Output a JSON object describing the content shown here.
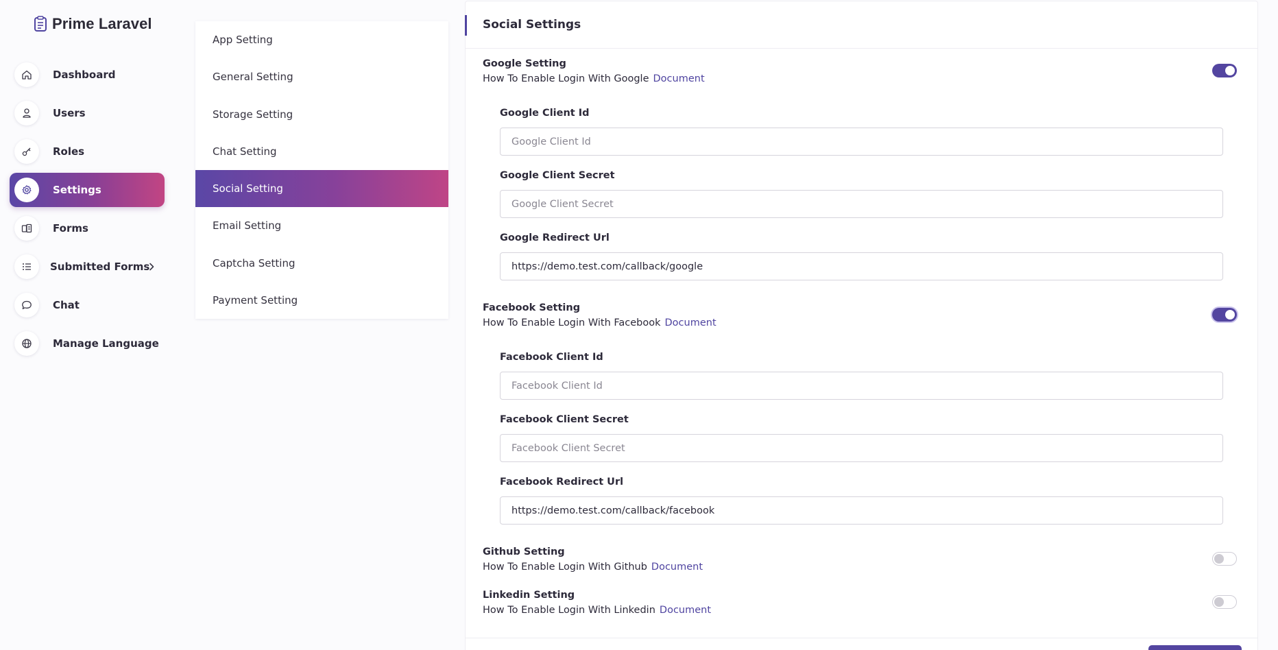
{
  "app": {
    "title": "Prime Laravel"
  },
  "sidebar": {
    "items": [
      {
        "label": "Dashboard",
        "icon": "home-icon"
      },
      {
        "label": "Users",
        "icon": "user-icon"
      },
      {
        "label": "Roles",
        "icon": "key-icon"
      },
      {
        "label": "Settings",
        "icon": "gear-icon",
        "active": true
      },
      {
        "label": "Forms",
        "icon": "form-icon"
      },
      {
        "label": "Submitted Forms",
        "icon": "list-icon",
        "expandable": true
      },
      {
        "label": "Chat",
        "icon": "chat-icon"
      },
      {
        "label": "Manage Language",
        "icon": "globe-icon"
      }
    ]
  },
  "submenu": {
    "items": [
      {
        "label": "App Setting"
      },
      {
        "label": "General Setting"
      },
      {
        "label": "Storage Setting"
      },
      {
        "label": "Chat Setting"
      },
      {
        "label": "Social Setting",
        "active": true
      },
      {
        "label": "Email Setting"
      },
      {
        "label": "Captcha Setting"
      },
      {
        "label": "Payment Setting"
      }
    ]
  },
  "main": {
    "title": "Social Settings",
    "google": {
      "title": "Google Setting",
      "desc": "How To Enable Login With Google",
      "doc": "Document",
      "enabled": true,
      "fields": [
        {
          "label": "Google Client Id",
          "placeholder": "Google Client Id",
          "value": ""
        },
        {
          "label": "Google Client Secret",
          "placeholder": "Google Client Secret",
          "value": ""
        },
        {
          "label": "Google Redirect Url",
          "placeholder": "",
          "value": "https://demo.test.com/callback/google"
        }
      ]
    },
    "facebook": {
      "title": "Facebook Setting",
      "desc": "How To Enable Login With Facebook",
      "doc": "Document",
      "enabled": true,
      "fields": [
        {
          "label": "Facebook Client Id",
          "placeholder": "Facebook Client Id",
          "value": ""
        },
        {
          "label": "Facebook Client Secret",
          "placeholder": "Facebook Client Secret",
          "value": ""
        },
        {
          "label": "Facebook Redirect Url",
          "placeholder": "",
          "value": "https://demo.test.com/callback/facebook"
        }
      ]
    },
    "github": {
      "title": "Github Setting",
      "desc": "How To Enable Login With Github",
      "doc": "Document",
      "enabled": false
    },
    "linkedin": {
      "title": "Linkedin Setting",
      "desc": "How To Enable Login With Linkedin",
      "doc": "Document",
      "enabled": false
    }
  },
  "colors": {
    "accent": "#5345a0",
    "gradient_start": "#5a47a6",
    "gradient_end": "#c24583"
  }
}
